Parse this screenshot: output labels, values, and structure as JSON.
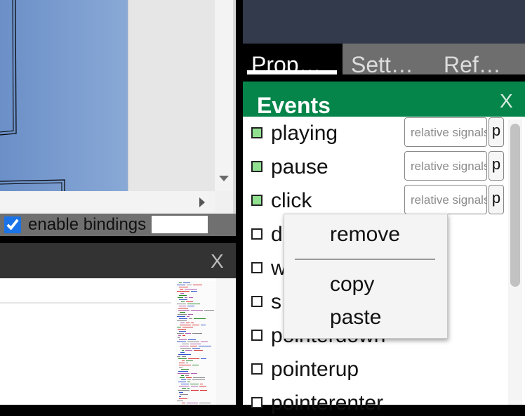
{
  "canvas": {
    "enable_bindings_label": "enable bindings",
    "enable_bindings_checked": true,
    "binding_input_value": ""
  },
  "code_panel": {
    "close_label": "X"
  },
  "tabs": [
    {
      "label": "Prop…",
      "active": true
    },
    {
      "label": "Sett…",
      "active": false
    },
    {
      "label": "Ref…",
      "active": false
    }
  ],
  "events_panel": {
    "title": "Events",
    "close_label": "X",
    "items": [
      {
        "name": "playing",
        "bound": true,
        "signal_placeholder": "relative signals",
        "p_label": "p"
      },
      {
        "name": "pause",
        "bound": true,
        "signal_placeholder": "relative signals",
        "p_label": "p"
      },
      {
        "name": "click",
        "bound": true,
        "signal_placeholder": "relative signals",
        "p_label": "p"
      },
      {
        "name": "d",
        "bound": false
      },
      {
        "name": "w",
        "bound": false
      },
      {
        "name": "s",
        "bound": false
      },
      {
        "name": "pointerdown",
        "bound": false
      },
      {
        "name": "pointerup",
        "bound": false
      },
      {
        "name": "pointerenter",
        "bound": false
      }
    ]
  },
  "context_menu": {
    "items": [
      "remove",
      "copy",
      "paste"
    ]
  },
  "colors": {
    "events_header": "#06854a",
    "bound_indicator": "#90e090",
    "top_bar": "#323a4c",
    "canvas_fill": "#7a9ccf"
  }
}
